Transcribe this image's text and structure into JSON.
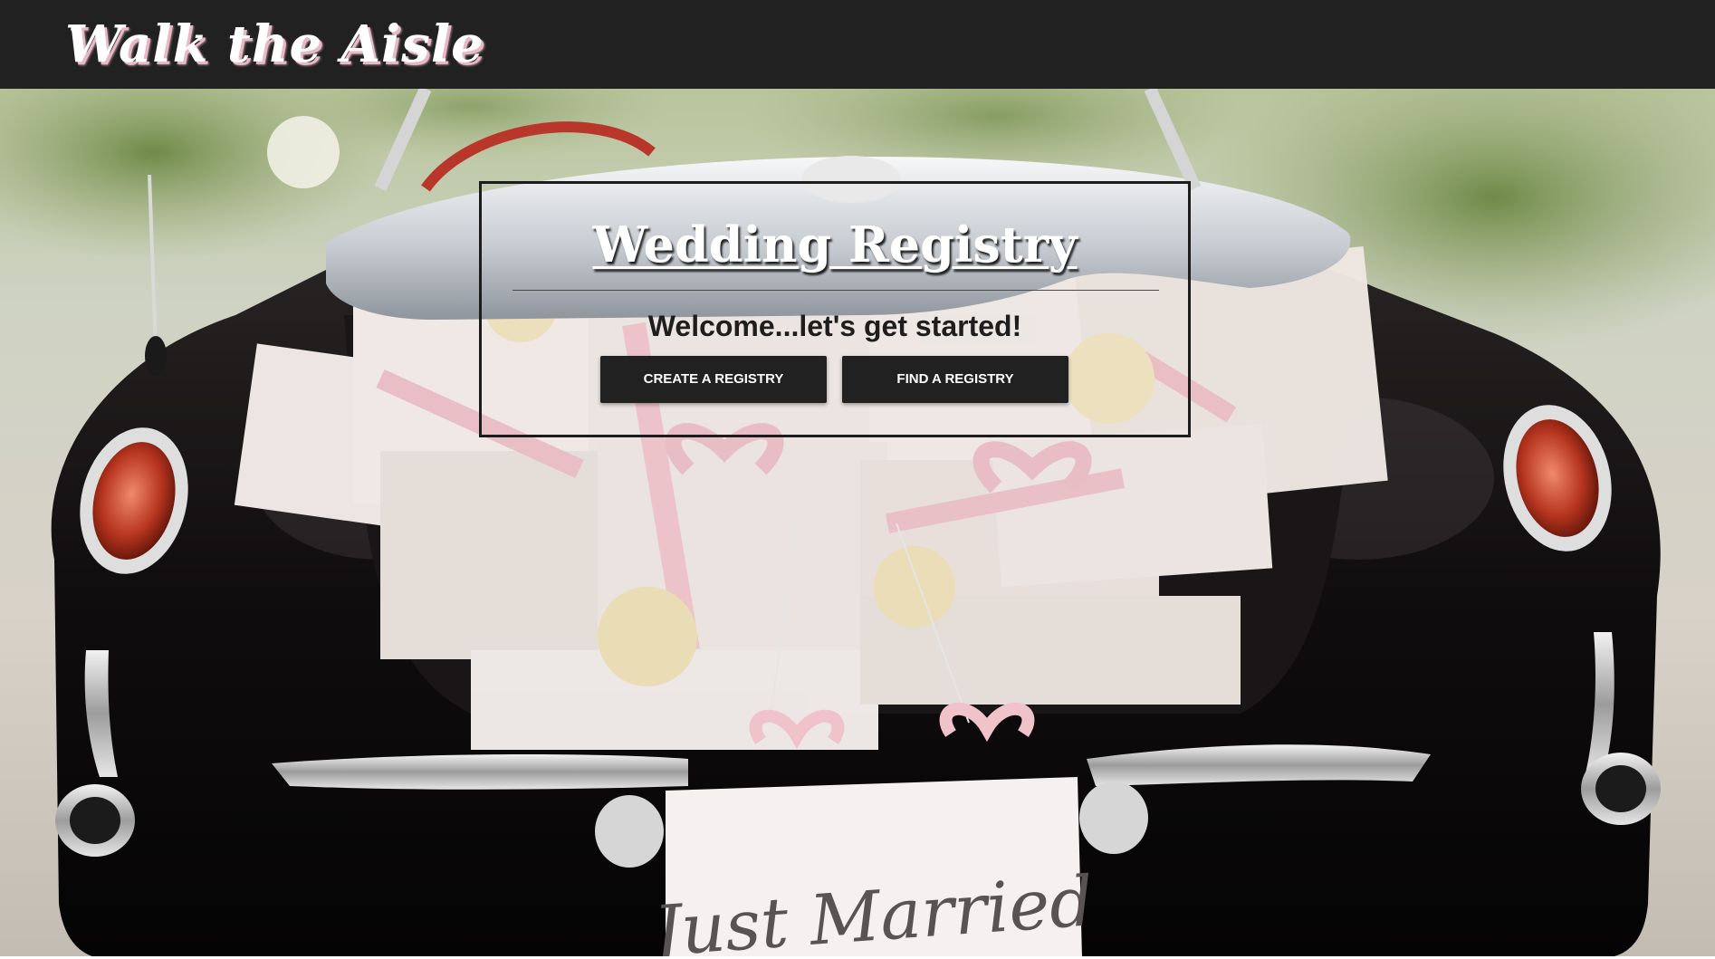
{
  "header": {
    "brand": "Walk the Aisle",
    "background_color": "#212121"
  },
  "hero": {
    "background_image": "vintage black convertible car trunk filled with white and pink gift boxes with a Just Married sign",
    "sign_text": "Just Married"
  },
  "registry_card": {
    "title": "Wedding Registry",
    "subtitle": "Welcome...let's get started!",
    "buttons": {
      "create_label": "CREATE A REGISTRY",
      "find_label": "FIND A REGISTRY"
    },
    "button_color": "#212121"
  }
}
